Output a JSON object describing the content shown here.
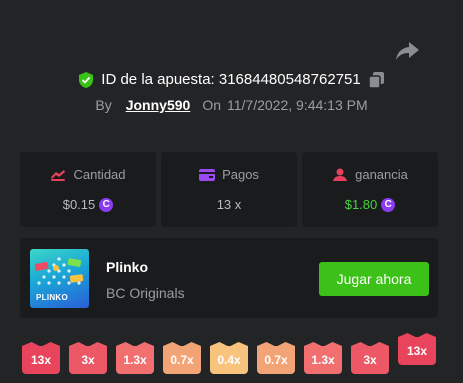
{
  "bet": {
    "id_label": "ID de la apuesta: 31684480548762751",
    "by_label": "By",
    "user": "Jonny590",
    "on_label": "On",
    "date": "11/7/2022, 9:44:13 PM"
  },
  "stats": {
    "amount": {
      "label": "Cantidad",
      "value": "$0.15",
      "icon": "chip-icon",
      "color": "#e6415c"
    },
    "payout": {
      "label": "Pagos",
      "value": "13 x",
      "icon": "wallet-icon",
      "color": "#9c49f0"
    },
    "profit": {
      "label": "ganancia",
      "value": "$1.80",
      "icon": "user-money-icon",
      "color": "#e6415c",
      "value_color": "#49d23e"
    }
  },
  "coin_symbol": "C",
  "game": {
    "thumbnail_title": "PLINKO",
    "name": "Plinko",
    "provider": "BC Originals",
    "play_label": "Jugar ahora"
  },
  "buckets": [
    {
      "label": "13x",
      "color": "#e8455c",
      "active": false
    },
    {
      "label": "3x",
      "color": "#ec5866",
      "active": false
    },
    {
      "label": "1.3x",
      "color": "#f26f6f",
      "active": false
    },
    {
      "label": "0.7x",
      "color": "#f3a477",
      "active": false
    },
    {
      "label": "0.4x",
      "color": "#f7c37d",
      "active": false
    },
    {
      "label": "0.7x",
      "color": "#f3a477",
      "active": false
    },
    {
      "label": "1.3x",
      "color": "#f26f6f",
      "active": false
    },
    {
      "label": "3x",
      "color": "#ec5866",
      "active": false
    },
    {
      "label": "13x",
      "color": "#e8455c",
      "active": true
    }
  ]
}
